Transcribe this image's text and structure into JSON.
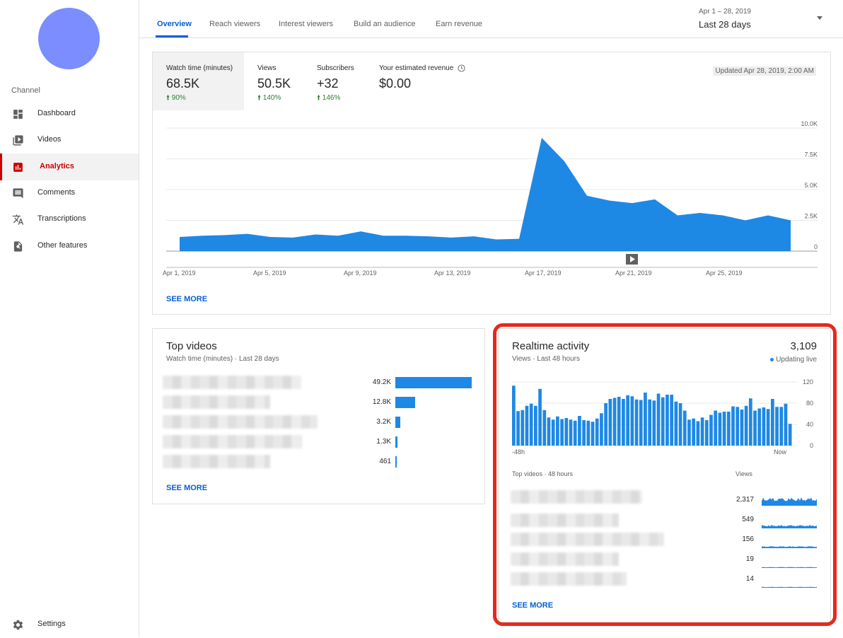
{
  "sidebar": {
    "section_label": "Channel",
    "items": [
      {
        "label": "Dashboard",
        "icon": "dashboard-icon"
      },
      {
        "label": "Videos",
        "icon": "video-icon"
      },
      {
        "label": "Analytics",
        "icon": "analytics-icon",
        "active": true
      },
      {
        "label": "Comments",
        "icon": "comment-icon"
      },
      {
        "label": "Transcriptions",
        "icon": "translate-icon"
      },
      {
        "label": "Other features",
        "icon": "other-features-icon"
      }
    ],
    "settings_label": "Settings"
  },
  "tabs": [
    "Overview",
    "Reach viewers",
    "Interest viewers",
    "Build an audience",
    "Earn revenue"
  ],
  "date": {
    "range": "Apr 1 – 28, 2019",
    "label": "Last 28 days"
  },
  "overview": {
    "metrics": [
      {
        "title": "Watch time (minutes)",
        "value": "68.5K",
        "change": "90%"
      },
      {
        "title": "Views",
        "value": "50.5K",
        "change": "140%"
      },
      {
        "title": "Subscribers",
        "value": "+32",
        "change": "146%"
      },
      {
        "title": "Your estimated revenue",
        "value": "$0.00",
        "change": ""
      }
    ],
    "updated": "Updated Apr 28, 2019, 2:00 AM",
    "see_more": "SEE MORE"
  },
  "chart_data": [
    {
      "type": "area",
      "x": [
        "Apr 1",
        "Apr 2",
        "Apr 3",
        "Apr 4",
        "Apr 5",
        "Apr 6",
        "Apr 7",
        "Apr 8",
        "Apr 9",
        "Apr 10",
        "Apr 11",
        "Apr 12",
        "Apr 13",
        "Apr 14",
        "Apr 15",
        "Apr 16",
        "Apr 17",
        "Apr 18",
        "Apr 19",
        "Apr 20",
        "Apr 21",
        "Apr 22",
        "Apr 23",
        "Apr 24",
        "Apr 25",
        "Apr 26",
        "Apr 27",
        "Apr 28"
      ],
      "series": [
        {
          "values": [
            1150,
            1250,
            1300,
            1400,
            1150,
            1100,
            1350,
            1250,
            1600,
            1250,
            1250,
            1200,
            1100,
            1200,
            950,
            1000,
            9200,
            7300,
            4500,
            4100,
            3900,
            4200,
            2900,
            3100,
            2900,
            2500,
            2900,
            2500
          ]
        }
      ],
      "x_tick_labels": [
        "Apr 1, 2019",
        "Apr 5, 2019",
        "Apr 9, 2019",
        "Apr 13, 2019",
        "Apr 17, 2019",
        "Apr 21, 2019",
        "Apr 25, 2019"
      ],
      "y_tick_labels": [
        "10.0K",
        "7.5K",
        "5.0K",
        "2.5K",
        "0"
      ],
      "ylim": [
        0,
        10000
      ],
      "grid": true,
      "color": "#1e88e5"
    },
    {
      "type": "bar",
      "title": "Realtime activity",
      "x_tick_labels": [
        "-48h",
        "Now"
      ],
      "y_tick_labels": [
        "120",
        "80",
        "40",
        "0"
      ],
      "ylim": [
        0,
        120
      ],
      "values": [
        113,
        65,
        67,
        75,
        79,
        75,
        107,
        67,
        53,
        49,
        55,
        50,
        52,
        49,
        47,
        56,
        48,
        47,
        45,
        51,
        61,
        80,
        88,
        90,
        92,
        88,
        95,
        93,
        87,
        86,
        100,
        87,
        85,
        98,
        91,
        96,
        96,
        83,
        80,
        66,
        49,
        51,
        46,
        53,
        48,
        58,
        66,
        62,
        64,
        64,
        74,
        73,
        68,
        75,
        89,
        66,
        70,
        72,
        69,
        88,
        73,
        73,
        79,
        41
      ],
      "color": "#1e88e5"
    }
  ],
  "top_videos": {
    "title": "Top videos",
    "subtitle": "Watch time (minutes) · Last 28 days",
    "rows": [
      {
        "value": "49.2K",
        "bar_fraction": 1.0
      },
      {
        "value": "12.8K",
        "bar_fraction": 0.26
      },
      {
        "value": "3.2K",
        "bar_fraction": 0.065
      },
      {
        "value": "1.3K",
        "bar_fraction": 0.026
      },
      {
        "value": "461",
        "bar_fraction": 0.009
      }
    ],
    "see_more": "SEE MORE"
  },
  "realtime": {
    "title": "Realtime activity",
    "total": "3,109",
    "subtitle": "Views · Last 48 hours",
    "live": "Updating live",
    "list_label": "Top videos · 48 hours",
    "views_label": "Views",
    "rows": [
      {
        "value": "2,317"
      },
      {
        "value": "549"
      },
      {
        "value": "156"
      },
      {
        "value": "19"
      },
      {
        "value": "14"
      }
    ],
    "see_more": "SEE MORE"
  }
}
